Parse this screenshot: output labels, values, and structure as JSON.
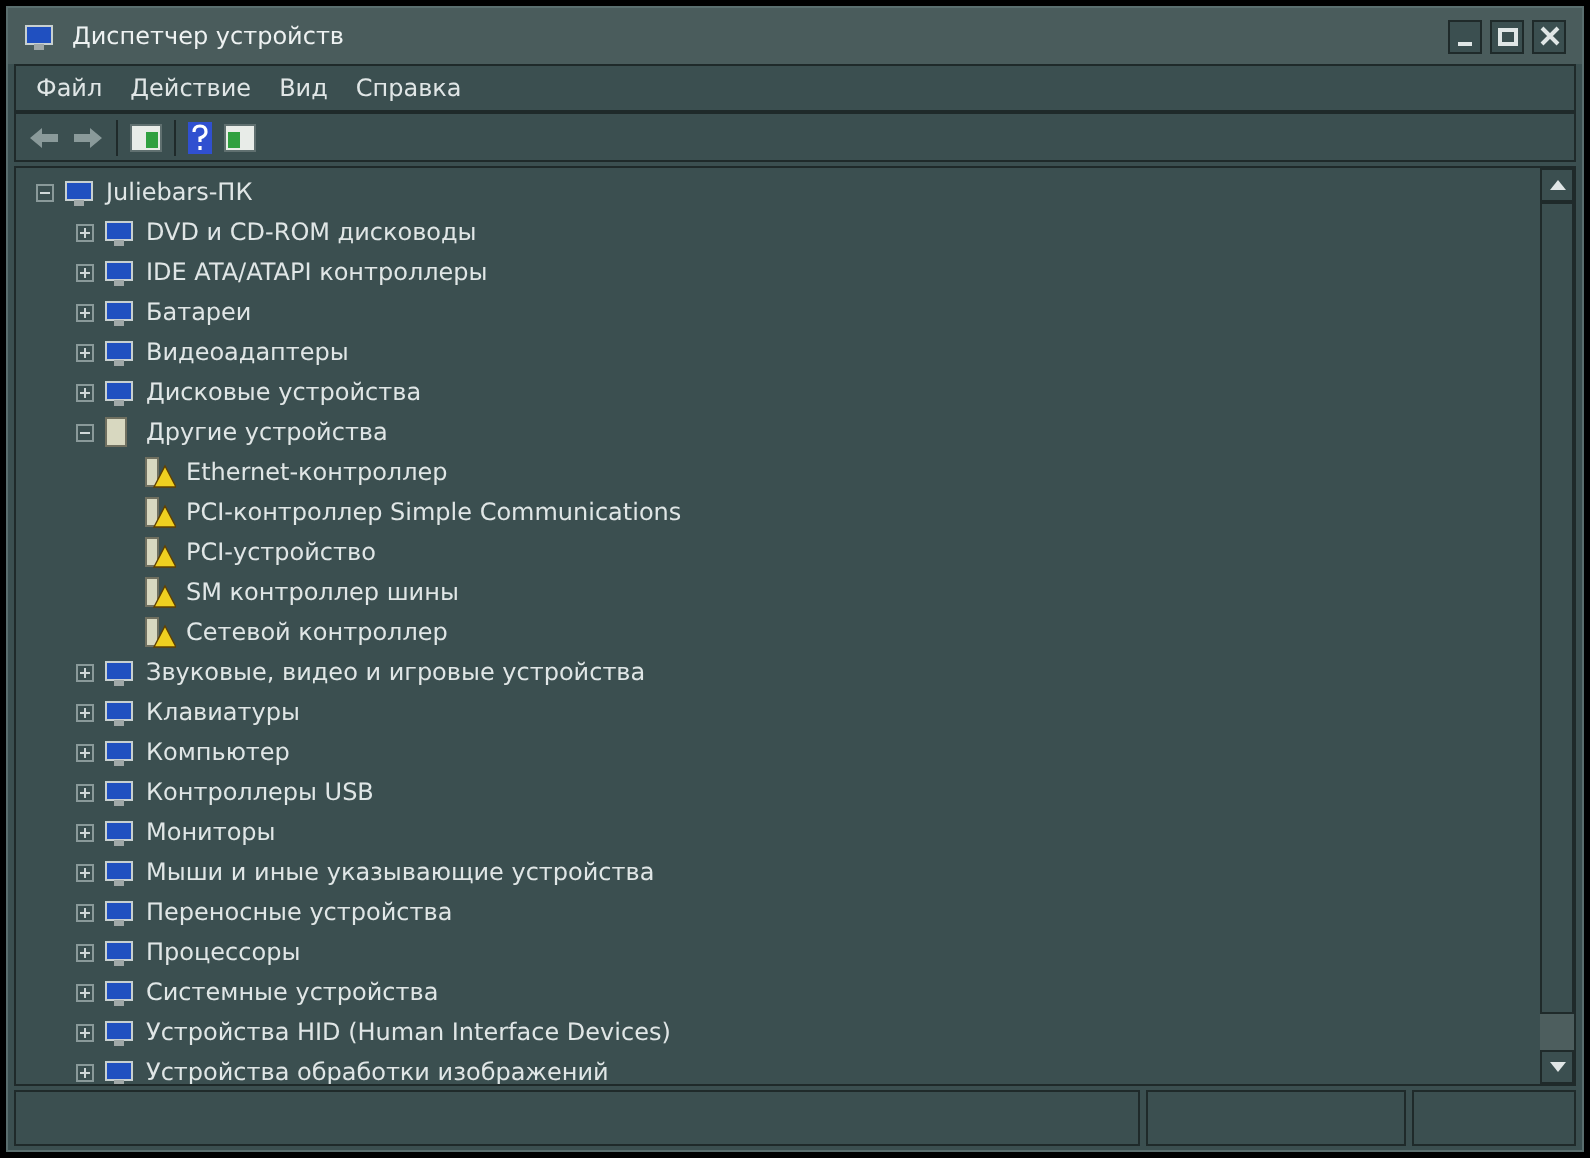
{
  "window": {
    "title": "Диспетчер устройств"
  },
  "menu": [
    "Файл",
    "Действие",
    "Вид",
    "Справка"
  ],
  "tree": {
    "label": "Juliebars-ПК",
    "expanded": true,
    "children": [
      {
        "label": "DVD и CD-ROM дисководы",
        "expanded": false
      },
      {
        "label": "IDE ATA/ATAPI контроллеры",
        "expanded": false
      },
      {
        "label": "Батареи",
        "expanded": false
      },
      {
        "label": "Видеоадаптеры",
        "expanded": false
      },
      {
        "label": "Дисковые устройства",
        "expanded": false
      },
      {
        "label": "Другие устройства",
        "expanded": true,
        "children": [
          {
            "label": "Ethernet-контроллер",
            "warning": true
          },
          {
            "label": "PCI-контроллер Simple Communications",
            "warning": true
          },
          {
            "label": "PCI-устройство",
            "warning": true
          },
          {
            "label": "SM контроллер шины",
            "warning": true
          },
          {
            "label": "Сетевой контроллер",
            "warning": true
          }
        ]
      },
      {
        "label": "Звуковые, видео и игровые устройства",
        "expanded": false
      },
      {
        "label": "Клавиатуры",
        "expanded": false
      },
      {
        "label": "Компьютер",
        "expanded": false
      },
      {
        "label": "Контроллеры USB",
        "expanded": false
      },
      {
        "label": "Мониторы",
        "expanded": false
      },
      {
        "label": "Мыши и иные указывающие устройства",
        "expanded": false
      },
      {
        "label": "Переносные устройства",
        "expanded": false
      },
      {
        "label": "Процессоры",
        "expanded": false
      },
      {
        "label": "Системные устройства",
        "expanded": false
      },
      {
        "label": "Устройства HID (Human Interface Devices)",
        "expanded": false
      },
      {
        "label": "Устройства обработки изображений",
        "expanded": false
      }
    ]
  }
}
